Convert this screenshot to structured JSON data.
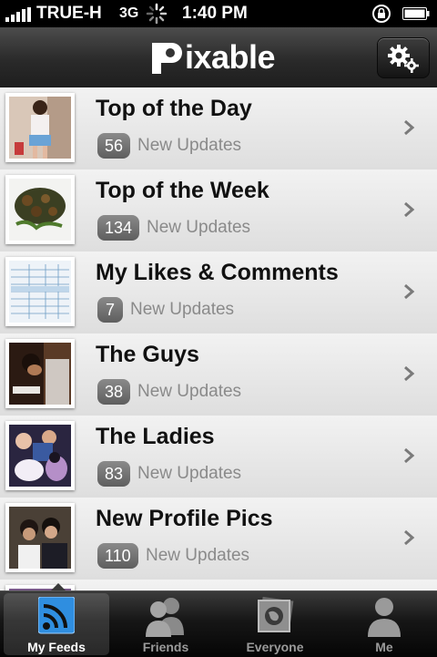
{
  "status_bar": {
    "carrier": "TRUE-H",
    "network": "3G",
    "time": "1:40 PM"
  },
  "app": {
    "logo_text": "ixable",
    "logo_full": "Pixable",
    "settings_icon": "gear-icon"
  },
  "feeds": [
    {
      "title": "Top of the Day",
      "count": "56",
      "updates_label": "New Updates"
    },
    {
      "title": "Top of the Week",
      "count": "134",
      "updates_label": "New Updates"
    },
    {
      "title": "My Likes & Comments",
      "count": "7",
      "updates_label": "New Updates"
    },
    {
      "title": "The Guys",
      "count": "38",
      "updates_label": "New Updates"
    },
    {
      "title": "The Ladies",
      "count": "83",
      "updates_label": "New Updates"
    },
    {
      "title": "New Profile Pics",
      "count": "110",
      "updates_label": "New Updates"
    }
  ],
  "tabs": [
    {
      "label": "My Feeds",
      "icon": "feed-icon",
      "active": true
    },
    {
      "label": "Friends",
      "icon": "friends-icon",
      "active": false
    },
    {
      "label": "Everyone",
      "icon": "globe-photo-icon",
      "active": false
    },
    {
      "label": "Me",
      "icon": "person-icon",
      "active": false
    }
  ]
}
